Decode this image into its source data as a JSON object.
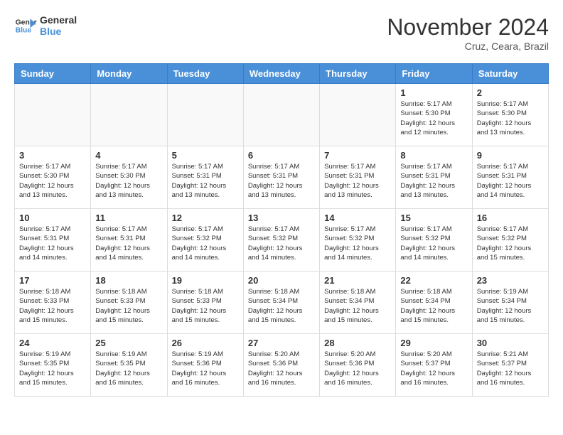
{
  "header": {
    "logo_line1": "General",
    "logo_line2": "Blue",
    "month": "November 2024",
    "location": "Cruz, Ceara, Brazil"
  },
  "weekdays": [
    "Sunday",
    "Monday",
    "Tuesday",
    "Wednesday",
    "Thursday",
    "Friday",
    "Saturday"
  ],
  "weeks": [
    [
      {
        "day": "",
        "info": ""
      },
      {
        "day": "",
        "info": ""
      },
      {
        "day": "",
        "info": ""
      },
      {
        "day": "",
        "info": ""
      },
      {
        "day": "",
        "info": ""
      },
      {
        "day": "1",
        "info": "Sunrise: 5:17 AM\nSunset: 5:30 PM\nDaylight: 12 hours and 12 minutes."
      },
      {
        "day": "2",
        "info": "Sunrise: 5:17 AM\nSunset: 5:30 PM\nDaylight: 12 hours and 13 minutes."
      }
    ],
    [
      {
        "day": "3",
        "info": "Sunrise: 5:17 AM\nSunset: 5:30 PM\nDaylight: 12 hours and 13 minutes."
      },
      {
        "day": "4",
        "info": "Sunrise: 5:17 AM\nSunset: 5:30 PM\nDaylight: 12 hours and 13 minutes."
      },
      {
        "day": "5",
        "info": "Sunrise: 5:17 AM\nSunset: 5:31 PM\nDaylight: 12 hours and 13 minutes."
      },
      {
        "day": "6",
        "info": "Sunrise: 5:17 AM\nSunset: 5:31 PM\nDaylight: 12 hours and 13 minutes."
      },
      {
        "day": "7",
        "info": "Sunrise: 5:17 AM\nSunset: 5:31 PM\nDaylight: 12 hours and 13 minutes."
      },
      {
        "day": "8",
        "info": "Sunrise: 5:17 AM\nSunset: 5:31 PM\nDaylight: 12 hours and 13 minutes."
      },
      {
        "day": "9",
        "info": "Sunrise: 5:17 AM\nSunset: 5:31 PM\nDaylight: 12 hours and 14 minutes."
      }
    ],
    [
      {
        "day": "10",
        "info": "Sunrise: 5:17 AM\nSunset: 5:31 PM\nDaylight: 12 hours and 14 minutes."
      },
      {
        "day": "11",
        "info": "Sunrise: 5:17 AM\nSunset: 5:31 PM\nDaylight: 12 hours and 14 minutes."
      },
      {
        "day": "12",
        "info": "Sunrise: 5:17 AM\nSunset: 5:32 PM\nDaylight: 12 hours and 14 minutes."
      },
      {
        "day": "13",
        "info": "Sunrise: 5:17 AM\nSunset: 5:32 PM\nDaylight: 12 hours and 14 minutes."
      },
      {
        "day": "14",
        "info": "Sunrise: 5:17 AM\nSunset: 5:32 PM\nDaylight: 12 hours and 14 minutes."
      },
      {
        "day": "15",
        "info": "Sunrise: 5:17 AM\nSunset: 5:32 PM\nDaylight: 12 hours and 14 minutes."
      },
      {
        "day": "16",
        "info": "Sunrise: 5:17 AM\nSunset: 5:32 PM\nDaylight: 12 hours and 15 minutes."
      }
    ],
    [
      {
        "day": "17",
        "info": "Sunrise: 5:18 AM\nSunset: 5:33 PM\nDaylight: 12 hours and 15 minutes."
      },
      {
        "day": "18",
        "info": "Sunrise: 5:18 AM\nSunset: 5:33 PM\nDaylight: 12 hours and 15 minutes."
      },
      {
        "day": "19",
        "info": "Sunrise: 5:18 AM\nSunset: 5:33 PM\nDaylight: 12 hours and 15 minutes."
      },
      {
        "day": "20",
        "info": "Sunrise: 5:18 AM\nSunset: 5:34 PM\nDaylight: 12 hours and 15 minutes."
      },
      {
        "day": "21",
        "info": "Sunrise: 5:18 AM\nSunset: 5:34 PM\nDaylight: 12 hours and 15 minutes."
      },
      {
        "day": "22",
        "info": "Sunrise: 5:18 AM\nSunset: 5:34 PM\nDaylight: 12 hours and 15 minutes."
      },
      {
        "day": "23",
        "info": "Sunrise: 5:19 AM\nSunset: 5:34 PM\nDaylight: 12 hours and 15 minutes."
      }
    ],
    [
      {
        "day": "24",
        "info": "Sunrise: 5:19 AM\nSunset: 5:35 PM\nDaylight: 12 hours and 15 minutes."
      },
      {
        "day": "25",
        "info": "Sunrise: 5:19 AM\nSunset: 5:35 PM\nDaylight: 12 hours and 16 minutes."
      },
      {
        "day": "26",
        "info": "Sunrise: 5:19 AM\nSunset: 5:36 PM\nDaylight: 12 hours and 16 minutes."
      },
      {
        "day": "27",
        "info": "Sunrise: 5:20 AM\nSunset: 5:36 PM\nDaylight: 12 hours and 16 minutes."
      },
      {
        "day": "28",
        "info": "Sunrise: 5:20 AM\nSunset: 5:36 PM\nDaylight: 12 hours and 16 minutes."
      },
      {
        "day": "29",
        "info": "Sunrise: 5:20 AM\nSunset: 5:37 PM\nDaylight: 12 hours and 16 minutes."
      },
      {
        "day": "30",
        "info": "Sunrise: 5:21 AM\nSunset: 5:37 PM\nDaylight: 12 hours and 16 minutes."
      }
    ]
  ]
}
